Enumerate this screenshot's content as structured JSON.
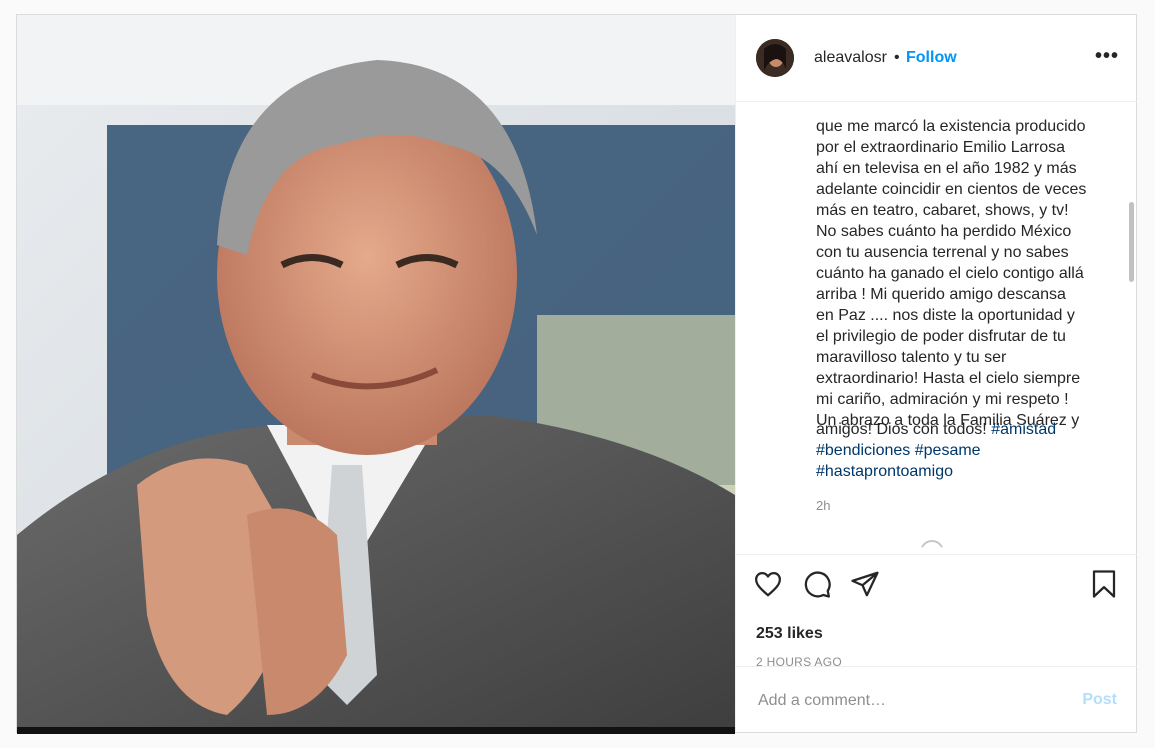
{
  "post": {
    "username": "aleavalosr",
    "separator": "•",
    "follow_label": "Follow",
    "more_label": "•••",
    "caption_lines": "que me marcó la existencia producido\npor el extraordinario Emilio Larrosa\nahí en televisa en el año 1982 y más\nadelante coincidir en cientos de veces\nmás en teatro, cabaret, shows, y tv!\nNo sabes cuánto ha perdido México\ncon tu ausencia terrenal y no sabes\ncuánto ha ganado el cielo contigo allá\narriba ! Mi querido amigo descansa\nen Paz .... nos diste la oportunidad y\nel privilegio de poder disfrutar de tu\nmaravilloso talento y tu ser\nextraordinario! Hasta el cielo siempre\nmi cariño, admiración y mi respeto !\nUn abrazo a toda la Familia Suárez y",
    "caption_tail": "amigos! Dios con todos! ",
    "hashtags": [
      "#amistad",
      "#bendiciones",
      "#pesame",
      "#hastaprontoamigo"
    ],
    "caption_time": "2h",
    "likes": "253 likes",
    "time_ago": "2 HOURS AGO",
    "comment_placeholder": "Add a comment…",
    "post_button": "Post"
  },
  "icons": {
    "like": "heart-icon",
    "comment": "comment-icon",
    "share": "paper-plane-icon",
    "save": "bookmark-icon",
    "more": "more-options-icon"
  },
  "colors": {
    "link_blue": "#0095f6",
    "hashtag_blue": "#00376b",
    "muted_gray": "#8e8e8e",
    "post_disabled": "#b2dffc"
  }
}
